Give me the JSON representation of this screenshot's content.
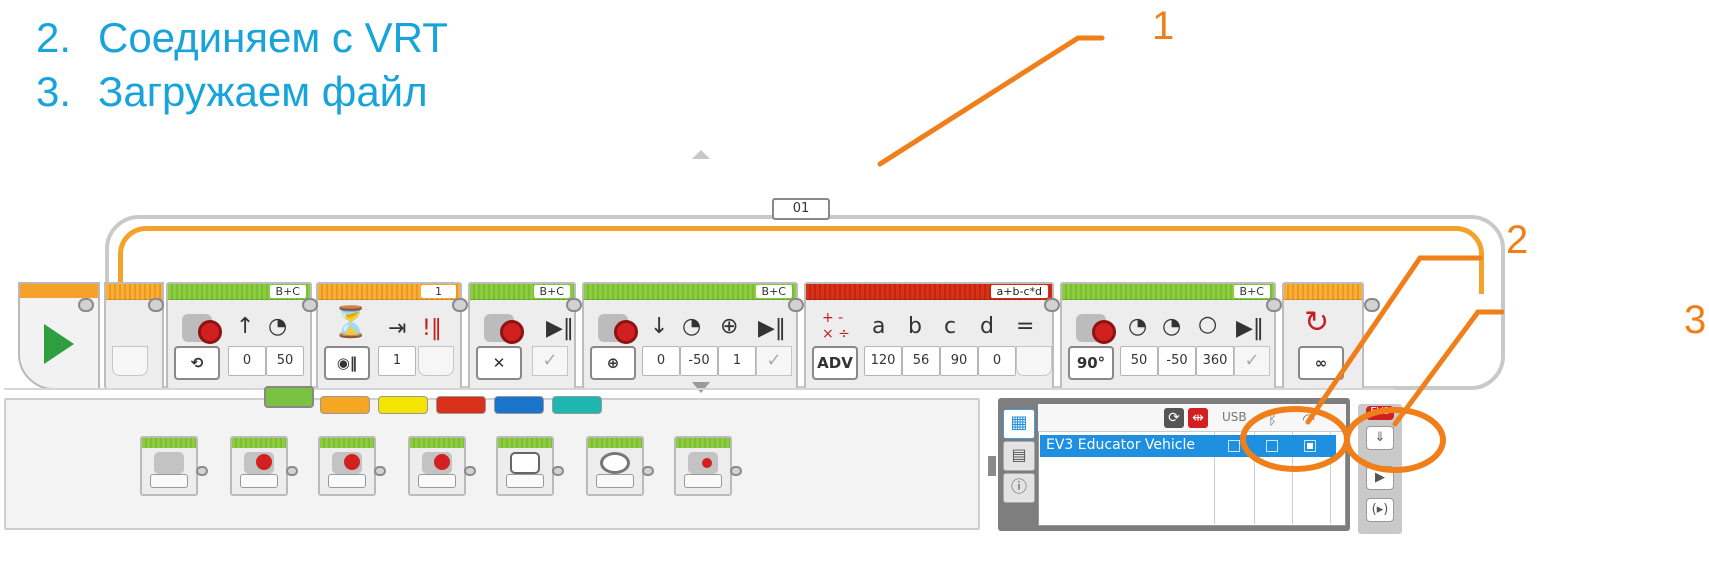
{
  "slide": {
    "steps": [
      {
        "number": "2.",
        "text": "Соединяем с VRT"
      },
      {
        "number": "3.",
        "text": "Загружаем файл"
      }
    ],
    "callouts": [
      "1",
      "2",
      "3"
    ],
    "accent_color": "#16a4db",
    "callout_color": "#f07f1a"
  },
  "program": {
    "loop_label": "01",
    "blocks": [
      {
        "id": "move-steering-1",
        "category": "action",
        "port": "B+C",
        "mode_icon": "on-icon",
        "direction_icon": "arrow-up-icon",
        "params": [
          "0",
          "50"
        ]
      },
      {
        "id": "wait",
        "category": "flow",
        "port": "1",
        "mode_icon": "hourglass-icon",
        "params": [
          "1"
        ]
      },
      {
        "id": "move-steering-2",
        "category": "action",
        "port": "B+C",
        "mode_label": "✕",
        "mode_icon": "off-icon",
        "params": []
      },
      {
        "id": "move-steering-3",
        "category": "action",
        "port": "B+C",
        "mode_icon": "degrees-icon",
        "direction_icon": "arrow-down-icon",
        "params": [
          "0",
          "-50",
          "1"
        ]
      },
      {
        "id": "math",
        "category": "data",
        "port": "a+b-c*d",
        "mode_label": "ADV",
        "vars": [
          "a",
          "b",
          "c",
          "d",
          "="
        ],
        "params": [
          "120",
          "56",
          "90",
          "0"
        ]
      },
      {
        "id": "tank",
        "category": "action",
        "port": "B+C",
        "mode_icon": "degrees-icon",
        "params": [
          "50",
          "-50",
          "360"
        ]
      },
      {
        "id": "loop-end",
        "category": "flow",
        "mode_label": "∞"
      }
    ]
  },
  "palette": {
    "tabs": [
      {
        "name": "action",
        "color": "#7cc242"
      },
      {
        "name": "flow",
        "color": "#f5a623"
      },
      {
        "name": "sensor",
        "color": "#f2e600"
      },
      {
        "name": "data",
        "color": "#d9301a"
      },
      {
        "name": "advanced",
        "color": "#1a74c9"
      },
      {
        "name": "my-blocks",
        "color": "#1fb5b0"
      }
    ],
    "blocks": [
      "medium-motor",
      "large-motor",
      "move-steering",
      "move-tank",
      "display",
      "sound",
      "brick-status-light"
    ]
  },
  "hardware": {
    "columns": {
      "usb": "USB",
      "bluetooth_icon": "bluetooth-icon",
      "wifi_icon": "wifi-icon"
    },
    "bricks": [
      {
        "name": "EV3 Educator Vehicle",
        "usb": false,
        "bluetooth": false,
        "wifi": true
      }
    ],
    "side_label": "EV3",
    "selection_color": "#1f8fe0"
  }
}
